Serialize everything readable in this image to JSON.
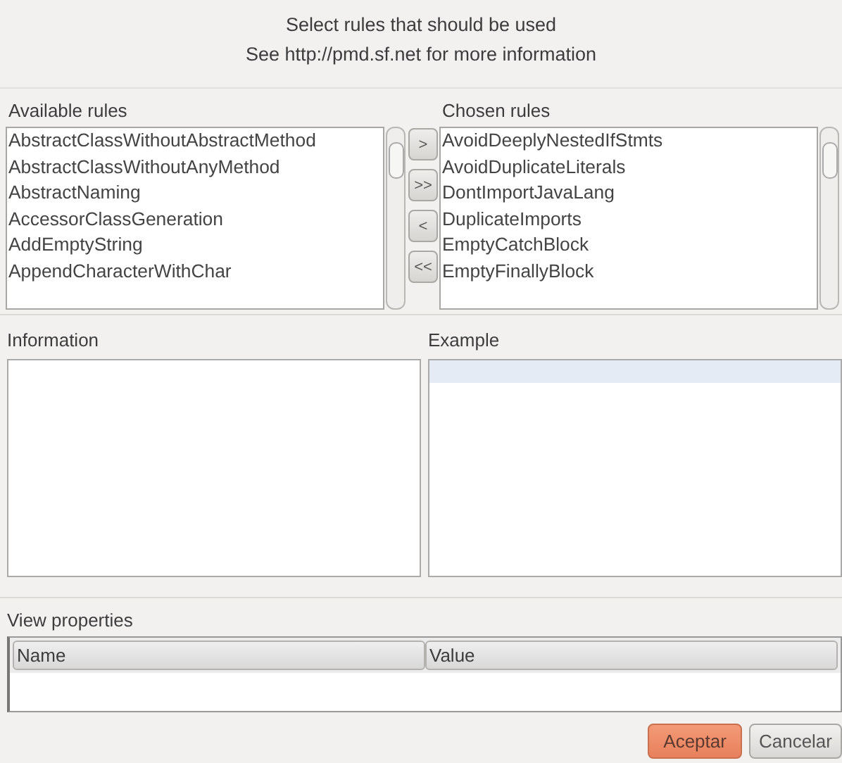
{
  "header": {
    "lines": [
      "Select rules that should be used",
      "See http://pmd.sf.net for more information"
    ]
  },
  "available_rules": {
    "label": "Available rules",
    "items": [
      "AbstractClassWithoutAbstractMethod",
      "AbstractClassWithoutAnyMethod",
      "AbstractNaming",
      "AccessorClassGeneration",
      "AddEmptyString",
      "AppendCharacterWithChar"
    ]
  },
  "transfer_buttons": [
    ">",
    ">>",
    "<",
    "<<"
  ],
  "chosen_rules": {
    "label": "Chosen rules",
    "items": [
      "AvoidDeeplyNestedIfStmts",
      "AvoidDuplicateLiterals",
      "DontImportJavaLang",
      "DuplicateImports",
      "EmptyCatchBlock",
      "EmptyFinallyBlock"
    ]
  },
  "information": {
    "label": "Information"
  },
  "example": {
    "label": "Example"
  },
  "properties": {
    "label": "View properties",
    "columns": [
      "Name",
      "Value"
    ]
  },
  "buttons": [
    {
      "label": "Aceptar",
      "default": true
    },
    {
      "label": "Cancelar",
      "default": false
    }
  ]
}
